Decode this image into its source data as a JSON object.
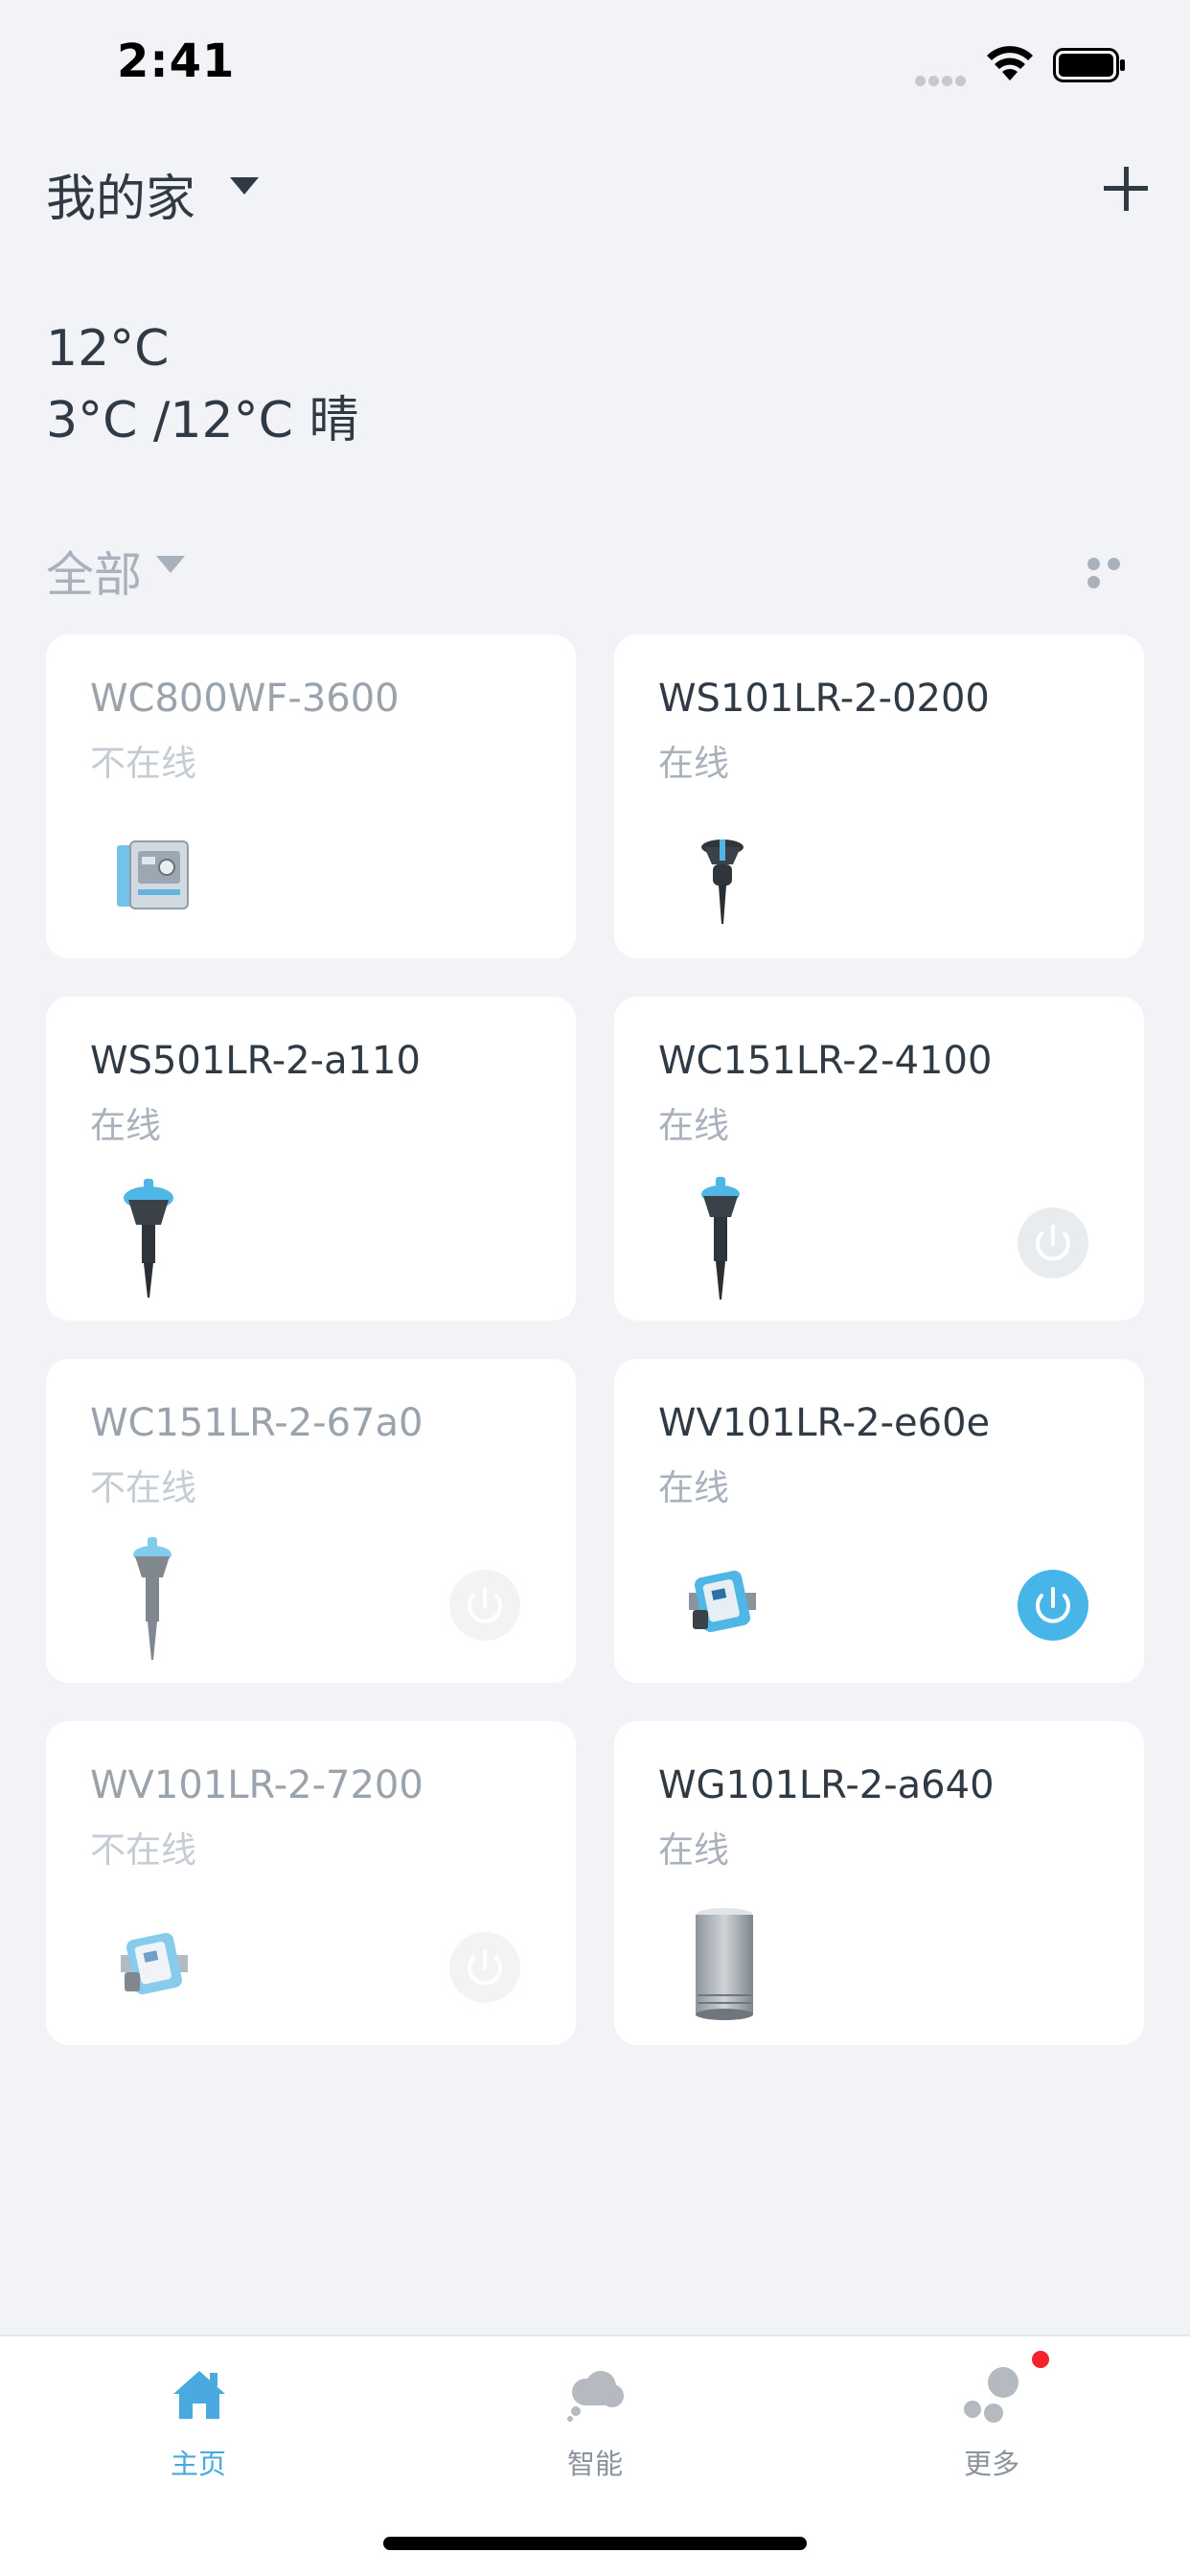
{
  "status_bar": {
    "time": "2:41"
  },
  "header": {
    "home_title": "我的家"
  },
  "weather": {
    "current_temp": "12°C",
    "range": "3°C /12°C 晴"
  },
  "filter": {
    "label": "全部"
  },
  "devices": [
    {
      "name": "WC800WF-3600",
      "status": "不在线"
    },
    {
      "name": "WS101LR-2-0200",
      "status": "在线"
    },
    {
      "name": "WS501LR-2-a110",
      "status": "在线"
    },
    {
      "name": "WC151LR-2-4100",
      "status": "在线"
    },
    {
      "name": "WC151LR-2-67a0",
      "status": "不在线"
    },
    {
      "name": "WV101LR-2-e60e",
      "status": "在线"
    },
    {
      "name": "WV101LR-2-7200",
      "status": "不在线"
    },
    {
      "name": "WG101LR-2-a640",
      "status": "在线"
    }
  ],
  "tabs": [
    {
      "label": "主页",
      "icon": "home-icon"
    },
    {
      "label": "智能",
      "icon": "cloud-icon"
    },
    {
      "label": "更多",
      "icon": "dots-icon"
    }
  ],
  "colors": {
    "accent": "#47b5e8",
    "badge": "#f5222d",
    "background": "#f2f3f7"
  }
}
